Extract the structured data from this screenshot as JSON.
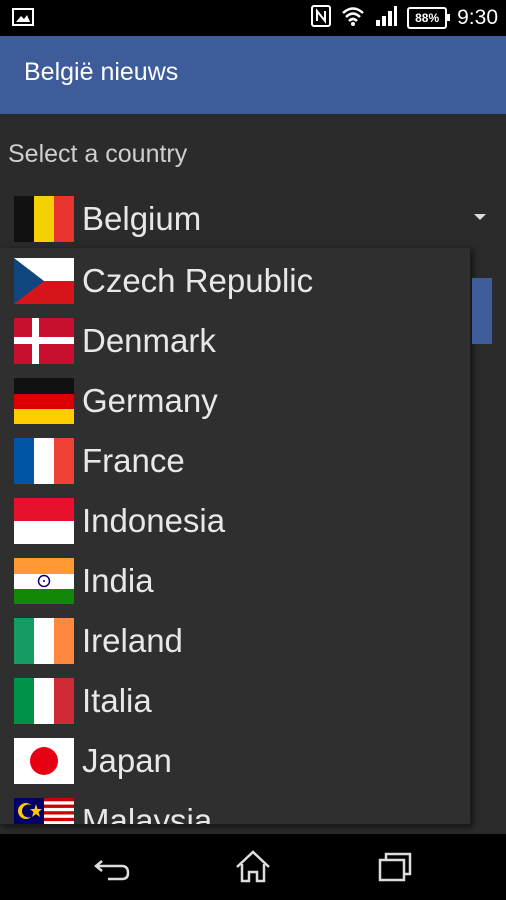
{
  "status_bar": {
    "time": "9:30",
    "battery": "88%",
    "icons": [
      "image-icon",
      "nfc-icon",
      "wifi-icon",
      "signal-icon",
      "battery-icon"
    ]
  },
  "app": {
    "title": "België nieuws"
  },
  "label": "Select a country",
  "spinner": {
    "selected": "Belgium",
    "flag": "be"
  },
  "countries": [
    {
      "name": "Czech Republic",
      "flag": "cz"
    },
    {
      "name": "Denmark",
      "flag": "dk"
    },
    {
      "name": "Germany",
      "flag": "de"
    },
    {
      "name": "France",
      "flag": "fr"
    },
    {
      "name": "Indonesia",
      "flag": "id"
    },
    {
      "name": "India",
      "flag": "in"
    },
    {
      "name": "Ireland",
      "flag": "ie"
    },
    {
      "name": "Italia",
      "flag": "it"
    },
    {
      "name": "Japan",
      "flag": "jp"
    },
    {
      "name": "Malaysia",
      "flag": "my"
    }
  ],
  "colors": {
    "accent": "#3e5b9a",
    "background": "#2b2b2b",
    "dropdown": "#2f2f2f"
  },
  "nav": [
    "back-icon",
    "home-icon",
    "recents-icon"
  ]
}
